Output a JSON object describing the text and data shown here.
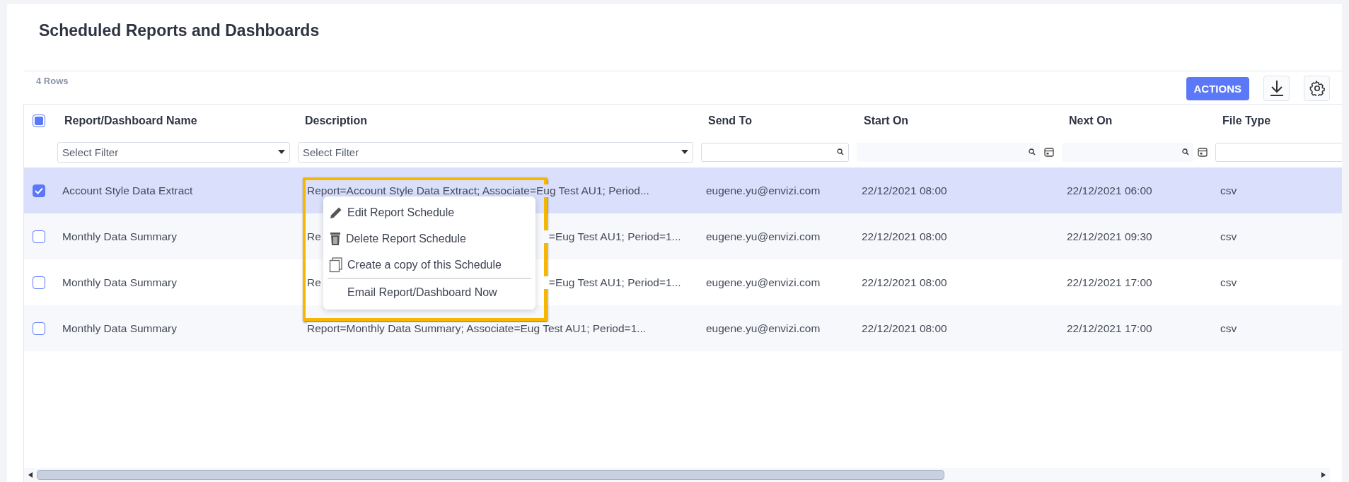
{
  "title": "Scheduled Reports and Dashboards",
  "row_count": "4 Rows",
  "toolbar": {
    "actions_label": "ACTIONS"
  },
  "table": {
    "select_all": {
      "indeterminate": true
    },
    "columns": [
      {
        "label": "Report/Dashboard Name",
        "kind": "select",
        "placeholder": "Select Filter"
      },
      {
        "label": "Description",
        "kind": "select",
        "placeholder": "Select Filter"
      },
      {
        "label": "Send To",
        "kind": "search"
      },
      {
        "label": "Start On",
        "kind": "date"
      },
      {
        "label": "Next On",
        "kind": "date"
      },
      {
        "label": "File Type",
        "kind": "text"
      }
    ],
    "rows": [
      {
        "selected": true,
        "checked": true,
        "name": "Account Style Data Extract",
        "description": [
          "Report=Account Style Data Extract; Associate=Eug Test AU1; Period..."
        ],
        "send_to": "eugene.yu@envizi.com",
        "start_on": "22/12/2021 08:00",
        "next_on": "22/12/2021 06:00",
        "file_type": "csv"
      },
      {
        "selected": false,
        "checked": false,
        "name": "Monthly Data Summary",
        "description": [
          "Re",
          "=Eug Test AU1; Period=1..."
        ],
        "send_to": "eugene.yu@envizi.com",
        "start_on": "22/12/2021 08:00",
        "next_on": "22/12/2021 09:30",
        "file_type": "csv"
      },
      {
        "selected": false,
        "checked": false,
        "name": "Monthly Data Summary",
        "description": [
          "Re",
          "=Eug Test AU1; Period=1..."
        ],
        "send_to": "eugene.yu@envizi.com",
        "start_on": "22/12/2021 08:00",
        "next_on": "22/12/2021 17:00",
        "file_type": "csv"
      },
      {
        "selected": false,
        "checked": false,
        "name": "Monthly Data Summary",
        "description": [
          "Report=Monthly Data Summary; Associate=Eug Test AU1; Period=1..."
        ],
        "send_to": "eugene.yu@envizi.com",
        "start_on": "22/12/2021 08:00",
        "next_on": "22/12/2021 17:00",
        "file_type": "csv"
      }
    ]
  },
  "context_menu": {
    "items": [
      {
        "kind": "edit",
        "label": "Edit Report Schedule"
      },
      {
        "kind": "delete",
        "label": "Delete Report Schedule"
      },
      {
        "kind": "copy",
        "label": "Create a copy of this Schedule"
      },
      {
        "kind": "plain",
        "label": "Email Report/Dashboard Now",
        "divider_before": true
      }
    ]
  }
}
